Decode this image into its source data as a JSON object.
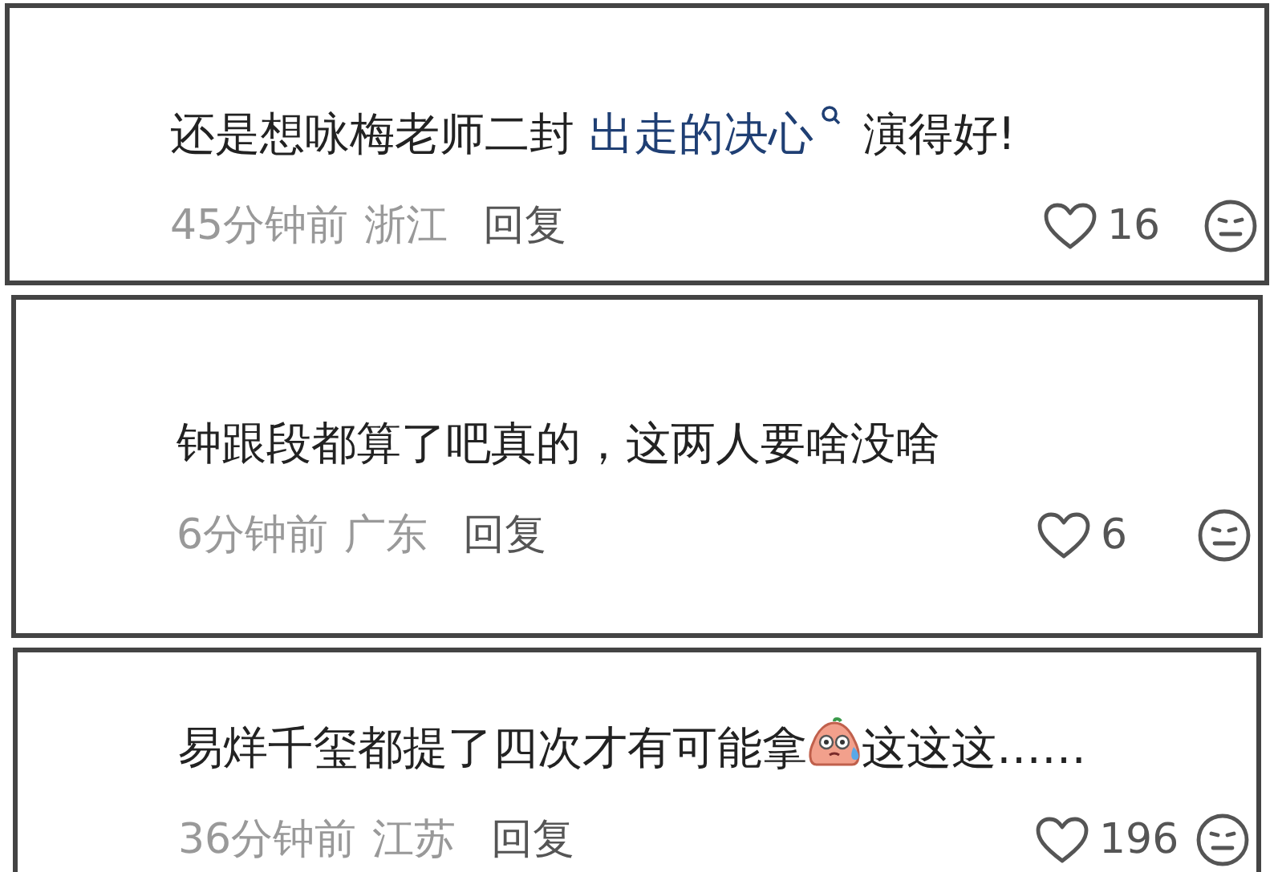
{
  "comments": [
    {
      "segments": [
        {
          "kind": "text",
          "text": "还是想咏梅老师二封 "
        },
        {
          "kind": "link",
          "text": "出走的决心"
        },
        {
          "kind": "text",
          "text": " 演得好!"
        }
      ],
      "time": "45分钟前",
      "region": "浙江",
      "reply": "回复",
      "likes": "16"
    },
    {
      "segments": [
        {
          "kind": "text",
          "text": "钟跟段都算了吧真的，这两人要啥没啥"
        }
      ],
      "time": "6分钟前",
      "region": "广东",
      "reply": "回复",
      "likes": "6"
    },
    {
      "segments": [
        {
          "kind": "text",
          "text": "易烊千玺都提了四次才有可能拿"
        },
        {
          "kind": "emoji"
        },
        {
          "kind": "text",
          "text": "这这这……"
        }
      ],
      "time": "36分钟前",
      "region": "江苏",
      "reply": "回复",
      "likes": "196"
    }
  ]
}
